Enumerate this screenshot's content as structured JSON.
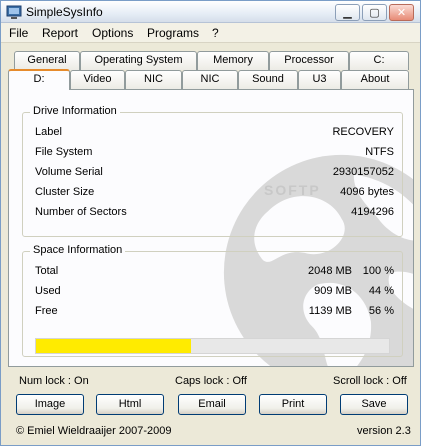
{
  "window": {
    "title": "SimpleSysInfo"
  },
  "menu": [
    "File",
    "Report",
    "Options",
    "Programs",
    "?"
  ],
  "tabs_row1": [
    "General",
    "Operating System",
    "Memory",
    "Processor",
    "C:"
  ],
  "tabs_row2": [
    "D:",
    "Video",
    "NIC",
    "NIC",
    "Sound",
    "U3",
    "About"
  ],
  "active_tab": "D:",
  "drive_info": {
    "title": "Drive Information",
    "rows": [
      {
        "label": "Label",
        "value": "RECOVERY"
      },
      {
        "label": "File System",
        "value": "NTFS"
      },
      {
        "label": "Volume Serial",
        "value": "2930157052"
      },
      {
        "label": "Cluster Size",
        "value": "4096 bytes"
      },
      {
        "label": "Number of Sectors",
        "value": "4194296"
      }
    ]
  },
  "space_info": {
    "title": "Space Information",
    "rows": [
      {
        "label": "Total",
        "mb": "2048 MB",
        "pct": "100 %"
      },
      {
        "label": "Used",
        "mb": "909 MB",
        "pct": "44 %"
      },
      {
        "label": "Free",
        "mb": "1139 MB",
        "pct": "56 %"
      }
    ],
    "used_fraction": 0.44,
    "bar_color": "#ffeb00"
  },
  "status": {
    "num_lock": "Num lock : On",
    "caps_lock": "Caps lock : Off",
    "scroll_lock": "Scroll lock : Off"
  },
  "buttons": [
    "Image",
    "Html",
    "Email",
    "Print",
    "Save"
  ],
  "footer": {
    "copyright": "© Emiel Wieldraaijer 2007-2009",
    "version": "version 2.3"
  },
  "watermark": "SOFTP"
}
